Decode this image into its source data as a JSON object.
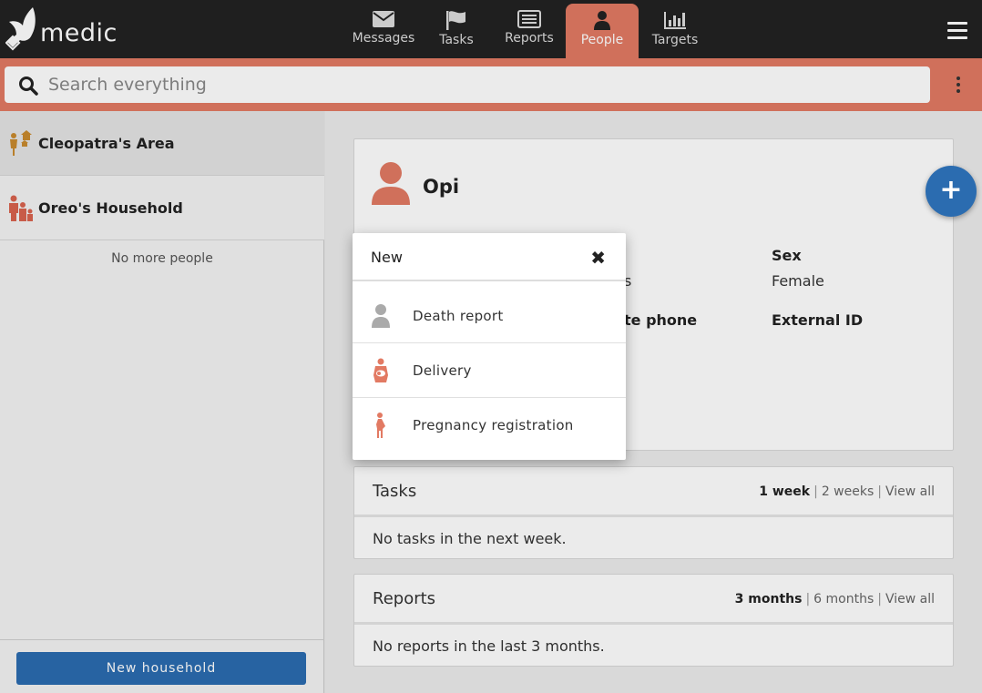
{
  "app": {
    "brand": "medic"
  },
  "nav": {
    "tabs": [
      {
        "label": "Messages",
        "icon": "envelope-icon"
      },
      {
        "label": "Tasks",
        "icon": "flag-icon"
      },
      {
        "label": "Reports",
        "icon": "list-icon"
      },
      {
        "label": "People",
        "icon": "person-icon",
        "active": true
      },
      {
        "label": "Targets",
        "icon": "bar-chart-icon"
      }
    ]
  },
  "search": {
    "placeholder": "Search everything"
  },
  "sidebar": {
    "items": [
      {
        "label": "Cleopatra's Area",
        "icon": "area-icon"
      },
      {
        "label": "Oreo's Household",
        "icon": "household-icon"
      }
    ],
    "empty_text": "No more people",
    "new_household_label": "New household"
  },
  "profile": {
    "name": "Opi",
    "partial_label_1": "s",
    "partial_label_2": "te phone",
    "sex_label": "Sex",
    "sex_value": "Female",
    "external_id_label": "External ID"
  },
  "tasks": {
    "title": "Tasks",
    "ranges": [
      "1 week",
      "2 weeks",
      "View all"
    ],
    "empty_text": "No tasks in the next week."
  },
  "reports": {
    "title": "Reports",
    "ranges": [
      "3 months",
      "6 months",
      "View all"
    ],
    "empty_text": "No reports in the last 3 months."
  },
  "fab": {
    "label": "+"
  },
  "popup": {
    "title": "New",
    "close_label": "✖",
    "items": [
      {
        "label": "Death report",
        "icon": "person-grey-icon"
      },
      {
        "label": "Delivery",
        "icon": "delivery-icon"
      },
      {
        "label": "Pregnancy registration",
        "icon": "pregnancy-icon"
      }
    ]
  },
  "colors": {
    "header": "#222222",
    "accent": "#e27a63",
    "primary": "#2b6cb0"
  }
}
